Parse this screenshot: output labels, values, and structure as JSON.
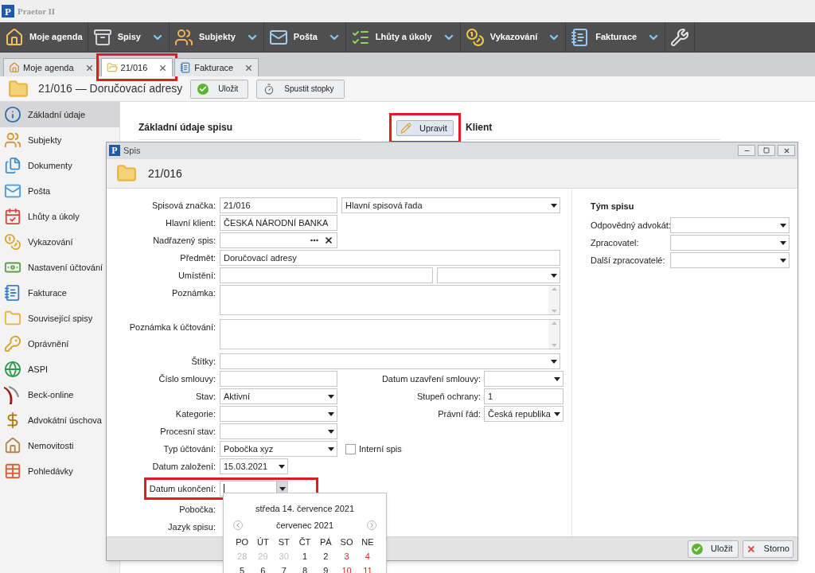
{
  "window": {
    "logo": "P",
    "title": "Praetor II"
  },
  "toolbar": [
    {
      "label": "Moje agenda",
      "menu": false
    },
    {
      "label": "Spisy",
      "menu": true
    },
    {
      "label": "Subjekty",
      "menu": true
    },
    {
      "label": "Pošta",
      "menu": true
    },
    {
      "label": "Lhůty a úkoly",
      "menu": true
    },
    {
      "label": "Vykazování",
      "menu": true
    },
    {
      "label": "Fakturace",
      "menu": true
    },
    {
      "kind": "tools",
      "menu": false
    }
  ],
  "tabs": [
    {
      "label": "Moje agenda",
      "selected": false,
      "highlighted": false
    },
    {
      "label": "21/016",
      "selected": true,
      "highlighted": true
    },
    {
      "label": "Fakturace",
      "selected": false,
      "highlighted": false
    }
  ],
  "header": {
    "title": "21/016 — Doručovací adresy",
    "buttons": [
      {
        "label": "Uložit",
        "kind": "save"
      },
      {
        "label": "Spustit stopky",
        "kind": "timer"
      }
    ]
  },
  "sidebar": {
    "items": [
      {
        "label": "Základní údaje",
        "selected": true
      },
      {
        "label": "Subjekty",
        "selected": false
      },
      {
        "label": "Dokumenty",
        "selected": false
      },
      {
        "label": "Pošta",
        "selected": false
      },
      {
        "label": "Lhůty a úkoly",
        "selected": false
      },
      {
        "label": "Vykazování",
        "selected": false
      },
      {
        "label": "Nastavení účtování",
        "selected": false
      },
      {
        "label": "Fakturace",
        "selected": false
      },
      {
        "label": "Související spisy",
        "selected": false
      },
      {
        "label": "Oprávnění",
        "selected": false
      },
      {
        "label": "ASPI",
        "selected": false
      },
      {
        "label": "Beck-online",
        "selected": false
      },
      {
        "label": "Advokátní úschova",
        "selected": false
      },
      {
        "label": "Nemovitosti",
        "selected": false
      },
      {
        "label": "Pohledávky",
        "selected": false
      }
    ]
  },
  "main": {
    "section_title": "Základní údaje spisu",
    "edit_button": {
      "label": "Upravit",
      "highlighted": true
    },
    "client_title": "Klient"
  },
  "dialog": {
    "logo": "P",
    "title": "Spis",
    "heading": "21/016",
    "form": [
      {
        "label": "Spisová značka:",
        "highlighted": false,
        "fields": [
          {
            "kind": "text",
            "value": "21/016"
          },
          {
            "kind": "select",
            "value": "Hlavní spisová řada"
          }
        ]
      },
      {
        "label": "Hlavní klient:",
        "highlighted": false,
        "fields": [
          {
            "kind": "readonly",
            "value": "ČESKÁ NÁRODNÍ BANKA"
          }
        ]
      },
      {
        "label": "Nadřazený spis:",
        "highlighted": false,
        "fields": [
          {
            "kind": "picker"
          }
        ]
      },
      {
        "label": "Předmět:",
        "highlighted": false,
        "fields": [
          {
            "kind": "text",
            "value": "Doručovací adresy"
          }
        ]
      },
      {
        "label": "Umístění:",
        "highlighted": false,
        "fields": [
          {
            "kind": "text"
          },
          {
            "kind": "select"
          }
        ]
      },
      {
        "label": "Poznámka:",
        "highlighted": false,
        "fields": [
          {
            "kind": "textarea"
          }
        ]
      },
      {
        "label": "Poznámka k účtování:",
        "highlighted": false,
        "fields": [
          {
            "kind": "textarea"
          }
        ]
      },
      {
        "label": "Štítky:",
        "highlighted": false,
        "fields": [
          {
            "kind": "select"
          }
        ]
      },
      {
        "label": "Číslo smlouvy:",
        "highlighted": false,
        "fields": [
          {
            "kind": "text"
          }
        ],
        "side": {
          "label": "Datum uzavření smlouvy:",
          "field": {
            "kind": "select"
          }
        }
      },
      {
        "label": "Stav:",
        "highlighted": false,
        "fields": [
          {
            "kind": "select",
            "value": "Aktivní"
          }
        ],
        "side": {
          "label": "Stupeň ochrany:",
          "field": {
            "kind": "text",
            "value": "1"
          }
        }
      },
      {
        "label": "Kategorie:",
        "highlighted": false,
        "fields": [
          {
            "kind": "select"
          }
        ],
        "side": {
          "label": "Právní řád:",
          "field": {
            "kind": "select",
            "value": "Česká republika"
          }
        }
      },
      {
        "label": "Procesní stav:",
        "highlighted": false,
        "fields": [
          {
            "kind": "select"
          }
        ]
      },
      {
        "label": "Typ účtování:",
        "highlighted": false,
        "fields": [
          {
            "kind": "select",
            "value": "Pobočka xyz"
          },
          {
            "kind": "checkbox",
            "label": "Interní spis",
            "checked": false
          }
        ]
      },
      {
        "label": "Datum založení:",
        "highlighted": false,
        "fields": [
          {
            "kind": "date",
            "value": "15.03.2021",
            "focused": false
          }
        ]
      },
      {
        "label": "Datum ukončení:",
        "highlighted": true,
        "fields": [
          {
            "kind": "date",
            "focused": true
          }
        ]
      },
      {
        "label": "Pobočka:",
        "highlighted": false
      },
      {
        "label": "Jazyk spisu:",
        "highlighted": false
      }
    ],
    "team_title": "Tým spisu",
    "team": [
      {
        "label": "Odpovědný advokát:"
      },
      {
        "label": "Zpracovatel:"
      },
      {
        "label": "Další zpracovatelé:"
      }
    ],
    "buttons": [
      {
        "label": "Uložit",
        "kind": "ok"
      },
      {
        "label": "Storno",
        "kind": "cancel"
      }
    ]
  },
  "calendar": {
    "today": "středa 14. července 2021",
    "month": "červenec 2021",
    "weekdays": [
      "PO",
      "ÚT",
      "ST",
      "ČT",
      "PÁ",
      "SO",
      "NE"
    ],
    "weeks": [
      [
        {
          "day": "28",
          "kind": "other"
        },
        {
          "day": "29",
          "kind": "other"
        },
        {
          "day": "30",
          "kind": "other"
        },
        {
          "day": "1",
          "kind": "weekday"
        },
        {
          "day": "2",
          "kind": "weekday"
        },
        {
          "day": "3",
          "kind": "weekend"
        },
        {
          "day": "4",
          "kind": "weekend"
        }
      ],
      [
        {
          "day": "5",
          "kind": "weekday"
        },
        {
          "day": "6",
          "kind": "weekday"
        },
        {
          "day": "7",
          "kind": "weekday"
        },
        {
          "day": "8",
          "kind": "weekday"
        },
        {
          "day": "9",
          "kind": "weekday"
        },
        {
          "day": "10",
          "kind": "weekend"
        },
        {
          "day": "11",
          "kind": "weekend"
        }
      ]
    ]
  }
}
